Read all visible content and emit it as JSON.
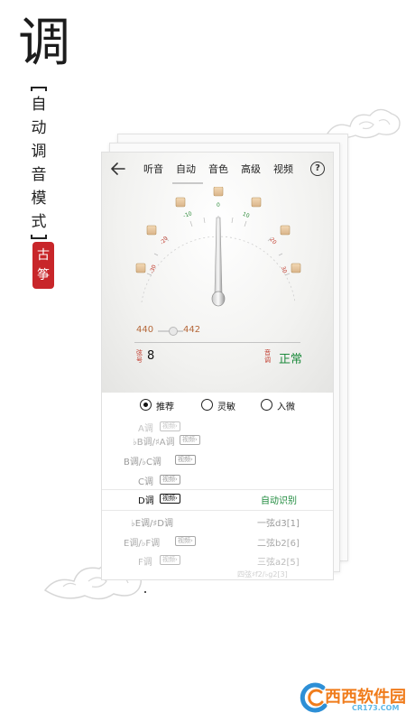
{
  "hero": {
    "big_char": "调",
    "mode_text": [
      "自",
      "动",
      "调",
      "音",
      "模",
      "式"
    ],
    "seal_chars": [
      "古",
      "筝"
    ]
  },
  "nav": {
    "tabs": [
      "听音",
      "自动",
      "音色",
      "高级",
      "视频"
    ],
    "active_tab": "自动",
    "help_label": "?"
  },
  "dial": {
    "scale_labels": {
      "left_near": "-10",
      "left_mid": "-20",
      "left_far": "-30",
      "center": "0",
      "right_near": "10",
      "right_mid": "20",
      "right_far": "30"
    },
    "needle_value": 0
  },
  "tuner": {
    "range_low": "440",
    "range_high": "442",
    "string_label": [
      "弦",
      "号"
    ],
    "string_number": "8",
    "pitch_label": [
      "音",
      "调"
    ],
    "status": "正常"
  },
  "sensitivity": {
    "options": [
      "推荐",
      "灵敏",
      "入微"
    ],
    "selected": "推荐"
  },
  "key_list": [
    {
      "key": "A调",
      "video": "视频",
      "right": ""
    },
    {
      "key": "♭B调/♯A调",
      "video": "视频",
      "right": ""
    },
    {
      "key": "B调/♭C调",
      "video": "视频",
      "right": ""
    },
    {
      "key": "C调",
      "video": "视频",
      "right": ""
    },
    {
      "key": "D调",
      "video": "视频",
      "right": "自动识别"
    },
    {
      "key": "♭E调/♯D调",
      "video": "",
      "right": "一弦d3[1]"
    },
    {
      "key": "E调/♭F调",
      "video": "视频",
      "right": "二弦b2[6]"
    },
    {
      "key": "F调",
      "video": "视频",
      "right": "三弦a2[5]"
    },
    {
      "key": "",
      "video": "",
      "right": "四弦♯f2/♭g2[3]"
    }
  ],
  "watermark": {
    "text": "西西软件园",
    "url": "CR173.COM"
  },
  "colors": {
    "status_green": "#1d8a3c",
    "scale_red": "#c0392b",
    "scale_green": "#2e8b3a",
    "seal_red": "#c8262a",
    "accent_brown": "#b5683a"
  }
}
